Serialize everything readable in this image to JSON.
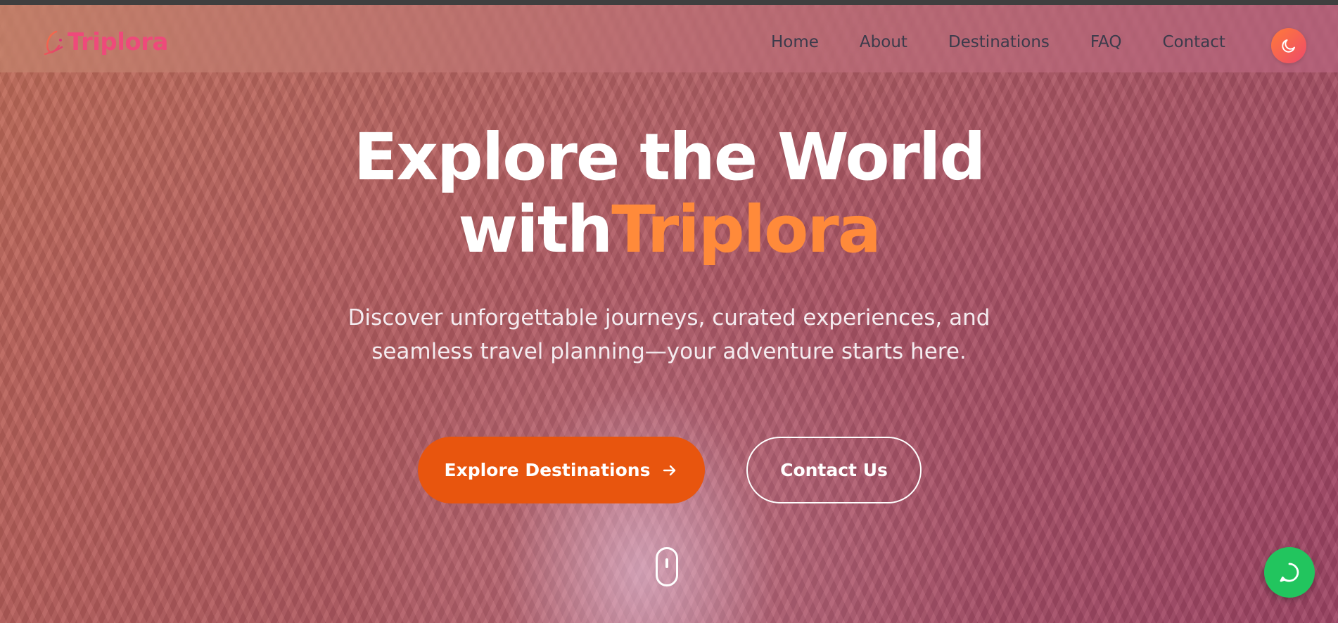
{
  "brand": {
    "name": "Triplora",
    "color": "#ee4a7a"
  },
  "nav": {
    "items": [
      {
        "label": "Home"
      },
      {
        "label": "About"
      },
      {
        "label": "Destinations"
      },
      {
        "label": "FAQ"
      },
      {
        "label": "Contact"
      }
    ],
    "theme_toggle_icon": "moon-icon"
  },
  "hero": {
    "headline_line1": "Explore the World",
    "headline_with": "with",
    "headline_accent": "Triplora",
    "subtext": "Discover unforgettable journeys, curated experiences, and seamless travel planning—your adventure starts here.",
    "primary_cta": "Explore Destinations",
    "secondary_cta": "Contact Us"
  },
  "colors": {
    "accent_orange": "#ff8a3a",
    "primary_button": "#e8550e",
    "chat_button": "#22c55e"
  },
  "widgets": {
    "chat_icon": "chat-bubble-icon",
    "scroll_icon": "mouse-scroll-icon"
  }
}
